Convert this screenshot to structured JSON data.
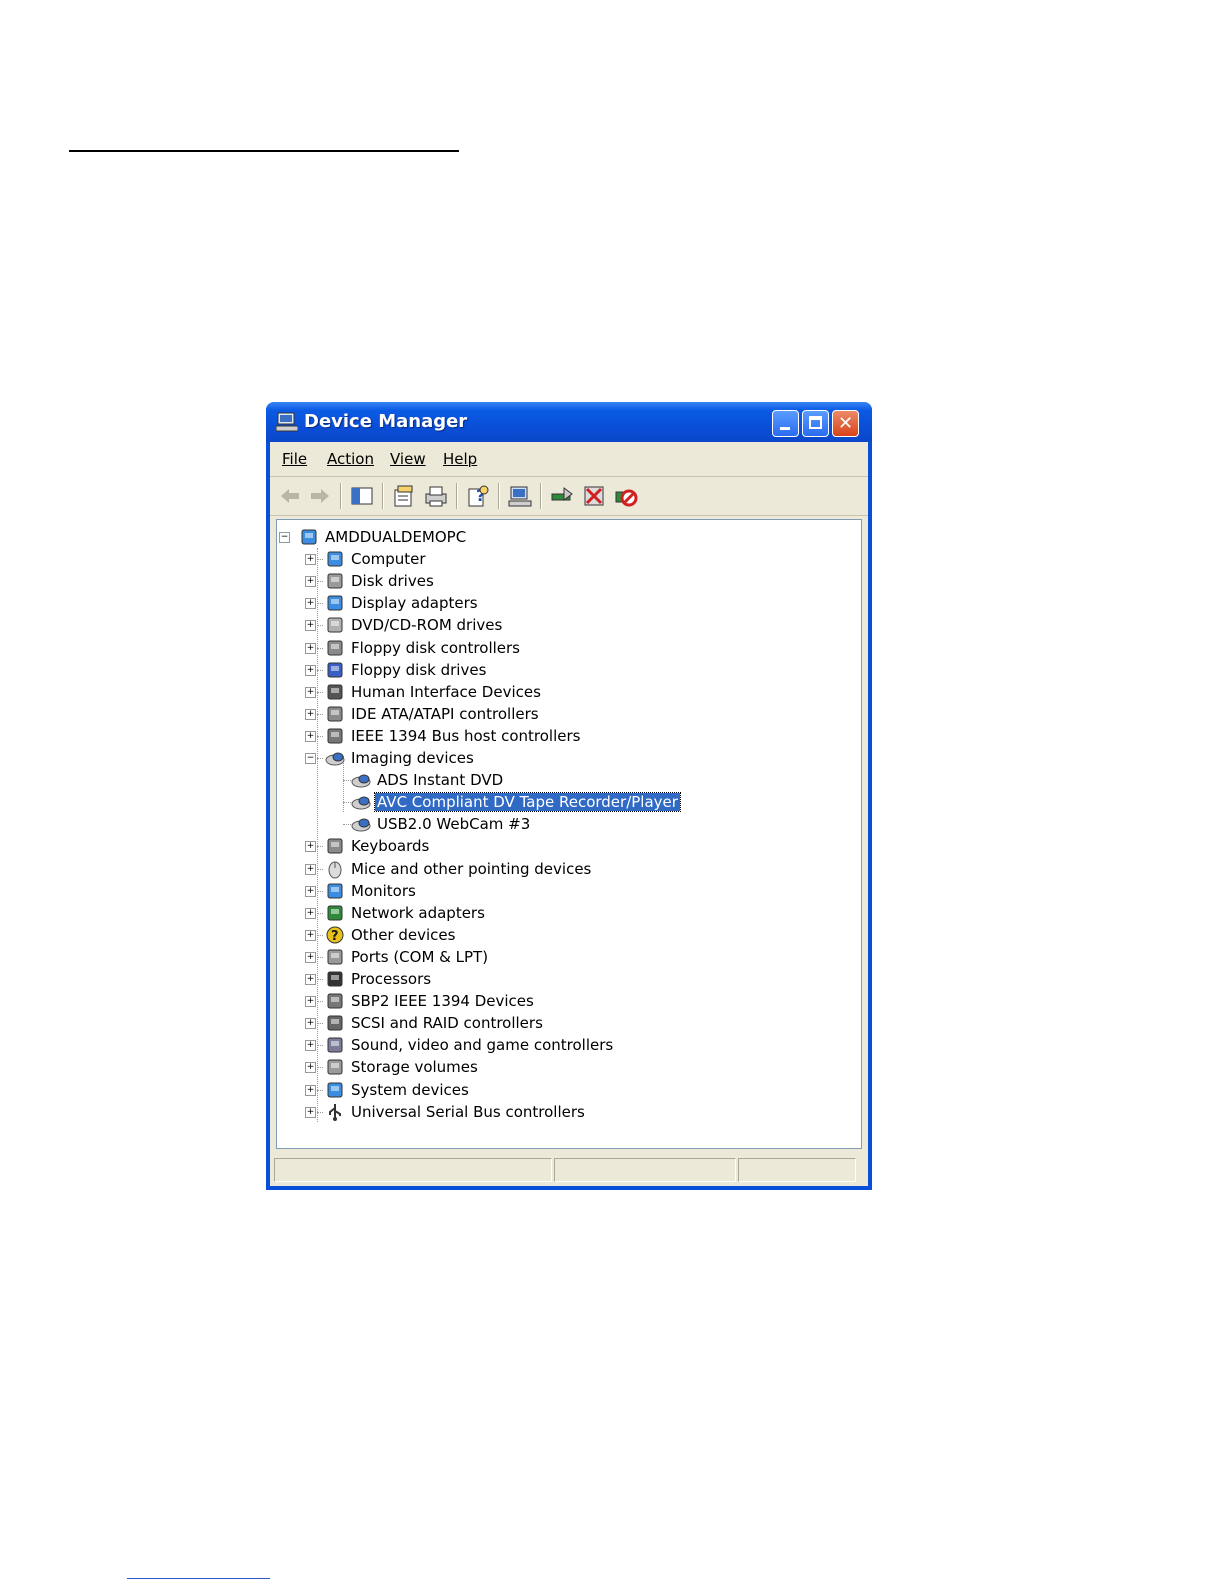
{
  "window": {
    "title": "Device Manager",
    "controls": {
      "minimize": "minimize",
      "maximize": "maximize",
      "close": "✕"
    }
  },
  "menu": [
    {
      "label": "File"
    },
    {
      "label": "Action"
    },
    {
      "label": "View"
    },
    {
      "label": "Help"
    }
  ],
  "toolbar": [
    {
      "icon": "back-arrow-icon"
    },
    {
      "icon": "forward-arrow-icon"
    },
    {
      "icon": "show-hide-console-tree-icon"
    },
    {
      "icon": "properties-icon"
    },
    {
      "icon": "print-icon"
    },
    {
      "icon": "help-icon"
    },
    {
      "icon": "scan-hardware-changes-icon"
    },
    {
      "icon": "update-driver-icon"
    },
    {
      "icon": "uninstall-icon"
    },
    {
      "icon": "disable-icon"
    }
  ],
  "tree": {
    "root": "AMDDUALDEMOPC",
    "categories": [
      {
        "label": "Computer",
        "icon": "computer-icon"
      },
      {
        "label": "Disk drives",
        "icon": "disk-drive-icon"
      },
      {
        "label": "Display adapters",
        "icon": "display-adapter-icon"
      },
      {
        "label": "DVD/CD-ROM drives",
        "icon": "dvd-drive-icon"
      },
      {
        "label": "Floppy disk controllers",
        "icon": "floppy-controller-icon"
      },
      {
        "label": "Floppy disk drives",
        "icon": "floppy-drive-icon"
      },
      {
        "label": "Human Interface Devices",
        "icon": "hid-icon"
      },
      {
        "label": "IDE ATA/ATAPI controllers",
        "icon": "ide-controller-icon"
      },
      {
        "label": "IEEE 1394 Bus host controllers",
        "icon": "ieee1394-icon"
      },
      {
        "label": "Imaging devices",
        "icon": "camera-icon",
        "expanded": true,
        "children": [
          {
            "label": "ADS Instant DVD"
          },
          {
            "label": "AVC Compliant DV Tape Recorder/Player",
            "selected": true
          },
          {
            "label": "USB2.0 WebCam #3"
          }
        ]
      },
      {
        "label": "Keyboards",
        "icon": "keyboard-icon"
      },
      {
        "label": "Mice and other pointing devices",
        "icon": "mouse-icon"
      },
      {
        "label": "Monitors",
        "icon": "monitor-icon"
      },
      {
        "label": "Network adapters",
        "icon": "network-adapter-icon"
      },
      {
        "label": "Other devices",
        "icon": "question-icon"
      },
      {
        "label": "Ports (COM & LPT)",
        "icon": "port-icon"
      },
      {
        "label": "Processors",
        "icon": "processor-icon"
      },
      {
        "label": "SBP2 IEEE 1394 Devices",
        "icon": "sbp2-icon"
      },
      {
        "label": "SCSI and RAID controllers",
        "icon": "scsi-icon"
      },
      {
        "label": "Sound, video and game controllers",
        "icon": "sound-icon"
      },
      {
        "label": "Storage volumes",
        "icon": "storage-volume-icon"
      },
      {
        "label": "System devices",
        "icon": "system-device-icon"
      },
      {
        "label": "Universal Serial Bus controllers",
        "icon": "usb-icon"
      }
    ]
  },
  "colors": {
    "title_bar": "#0a4fd8",
    "selection": "#316ac5",
    "window_face": "#ece9d8"
  }
}
